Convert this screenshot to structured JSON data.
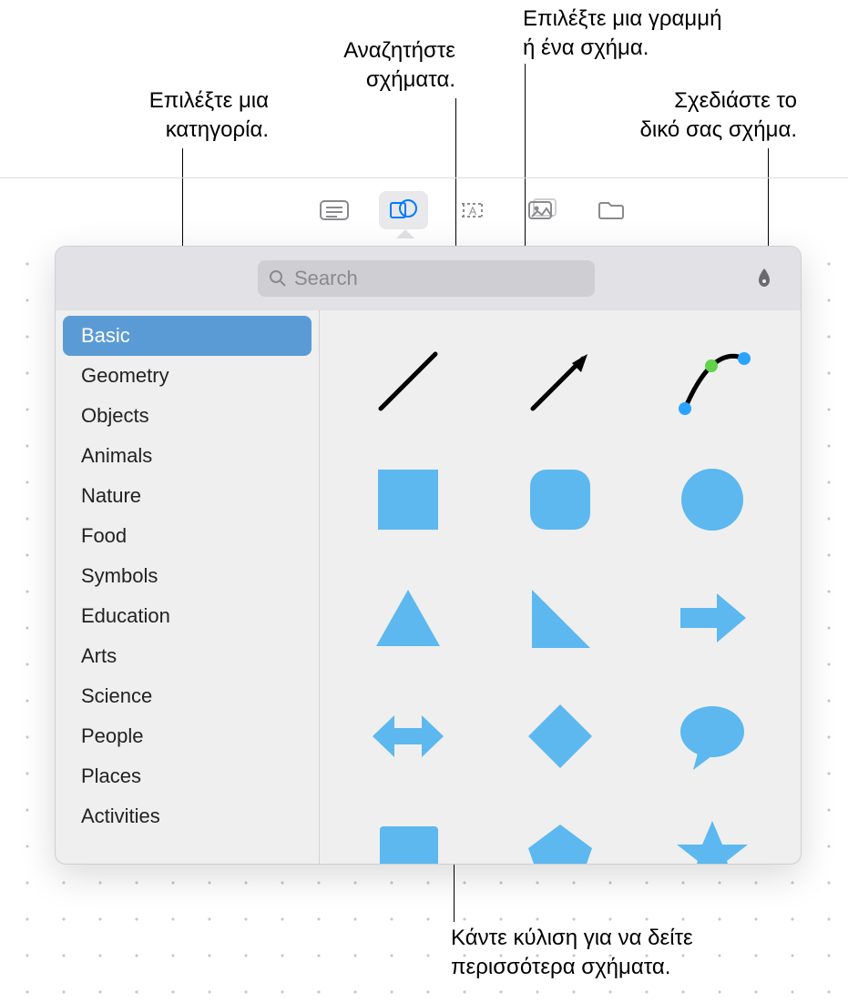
{
  "callouts": {
    "category": "Επιλέξτε μια\nκατηγορία.",
    "search": "Αναζητήστε\nσχήματα.",
    "line_or_shape": "Επιλέξτε μια γραμμή\nή ένα σχήμα.",
    "draw_own": "Σχεδιάστε το\nδικό σας σχήμα.",
    "scroll_more": "Κάντε κύλιση για να δείτε\nπερισσότερα σχήματα."
  },
  "search_placeholder": "Search",
  "categories": [
    "Basic",
    "Geometry",
    "Objects",
    "Animals",
    "Nature",
    "Food",
    "Symbols",
    "Education",
    "Arts",
    "Science",
    "People",
    "Places",
    "Activities"
  ],
  "selected_category_index": 0,
  "shapes": [
    "line",
    "arrow-line",
    "curve-editable",
    "square",
    "rounded-square",
    "circle",
    "triangle",
    "right-triangle",
    "arrow-right",
    "arrow-bidir",
    "diamond",
    "speech-bubble",
    "callout-rect",
    "pentagon",
    "star"
  ],
  "colors": {
    "accent": "#5cb8ef",
    "selection": "#5b9bd5"
  }
}
